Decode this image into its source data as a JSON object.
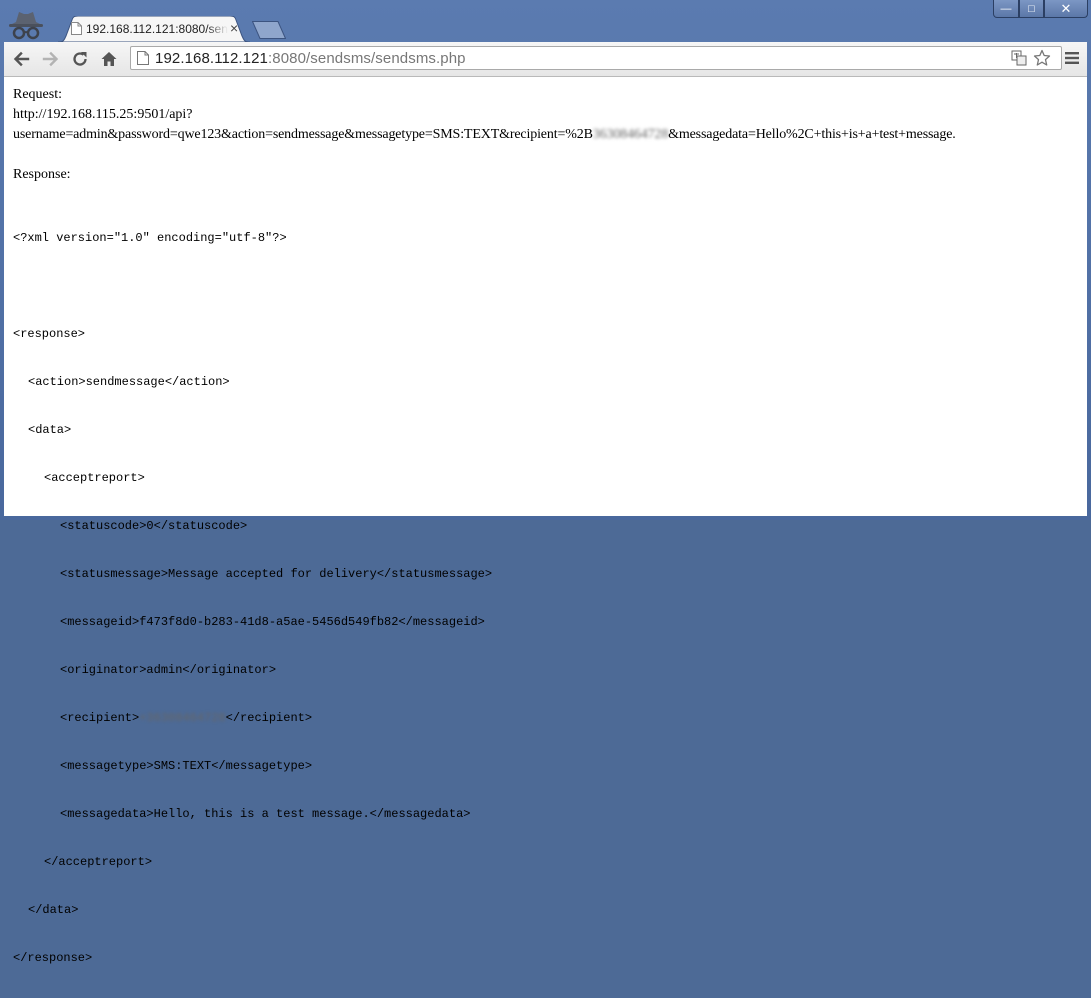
{
  "browser": {
    "tab_title": "192.168.112.121:8080/sendsms/sendsms.php",
    "tab_close": "×",
    "url_host": "192.168.112.121",
    "url_rest": ":8080/sendsms/sendsms.php",
    "win_min": "—",
    "win_max": "□",
    "win_close": "✕"
  },
  "request": {
    "label": "Request:",
    "line1": "http://192.168.115.25:9501/api?",
    "line2_pre": "username=admin&password=qwe123&action=sendmessage&messagetype=SMS:TEXT&recipient=%2B",
    "line2_redacted": "36308464728",
    "line2_post": "&messagedata=Hello%2C+this+is+a+test+message."
  },
  "response": {
    "label": "Response:",
    "xml_decl": "<?xml version=\"1.0\" encoding=\"utf-8\"?>",
    "open_response": "<response>",
    "action": "<action>sendmessage</action>",
    "open_data": "<data>",
    "open_acceptreport": "<acceptreport>",
    "statuscode": "<statuscode>0</statuscode>",
    "statusmessage": "<statusmessage>Message accepted for delivery</statusmessage>",
    "messageid": "<messageid>f473f8d0-b283-41d8-a5ae-5456d549fb82</messageid>",
    "originator": "<originator>admin</originator>",
    "recipient_pre": "<recipient>",
    "recipient_redacted": "+36308464728",
    "recipient_post": "</recipient>",
    "messagetype": "<messagetype>SMS:TEXT</messagetype>",
    "messagedata": "<messagedata>Hello, this is a test message.</messagedata>",
    "close_acceptreport": "</acceptreport>",
    "close_data": "</data>",
    "close_response": "</response>"
  }
}
